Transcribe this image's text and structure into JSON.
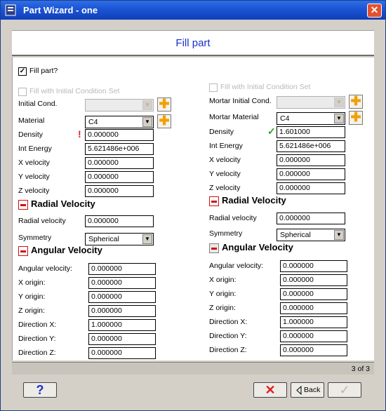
{
  "window": {
    "title": "Part Wizard - one",
    "close_glyph": "✕"
  },
  "header": {
    "title": "Fill part"
  },
  "fill_part": {
    "label": "Fill part?",
    "checked": true
  },
  "left": {
    "fill_initial_label": "Fill with Initial Condition Set",
    "initial_cond_label": "Initial Cond.",
    "material_label": "Material",
    "material_value": "C4",
    "density_label": "Density",
    "density_value": "0.000000",
    "int_energy_label": "Int Energy",
    "int_energy_value": "5.621486e+006",
    "x_velocity_label": "X velocity",
    "x_velocity_value": "0.000000",
    "y_velocity_label": "Y velocity",
    "y_velocity_value": "0.000000",
    "z_velocity_label": "Z velocity",
    "z_velocity_value": "0.000000",
    "radial_section_title": "Radial Velocity",
    "radial_velocity_label": "Radial velocity",
    "radial_velocity_value": "0.000000",
    "symmetry_label": "Symmetry",
    "symmetry_value": "Spherical",
    "angular_section_title": "Angular Velocity",
    "angular_velocity_label": "Angular velocity:",
    "angular_velocity_value": "0.000000",
    "x_origin_label": "X origin:",
    "x_origin_value": "0.000000",
    "y_origin_label": "Y origin:",
    "y_origin_value": "0.000000",
    "z_origin_label": "Z origin:",
    "z_origin_value": "0.000000",
    "direction_x_label": "Direction X:",
    "direction_x_value": "1.000000",
    "direction_y_label": "Direction Y:",
    "direction_y_value": "0.000000",
    "direction_z_label": "Direction Z:",
    "direction_z_value": "0.000000"
  },
  "right": {
    "fill_initial_label": "Fill with Initial Condition Set",
    "mortar_initial_label": "Mortar Initial Cond.",
    "mortar_material_label": "Mortar Material",
    "mortar_material_value": "C4",
    "density_label": "Density",
    "density_value": "1.601000",
    "int_energy_label": "Int Energy",
    "int_energy_value": "5.621486e+006",
    "x_velocity_label": "X velocity",
    "x_velocity_value": "0.000000",
    "y_velocity_label": "Y velocity",
    "y_velocity_value": "0.000000",
    "z_velocity_label": "Z velocity",
    "z_velocity_value": "0.000000",
    "radial_section_title": "Radial Velocity",
    "radial_velocity_label": "Radial velocity",
    "radial_velocity_value": "0.000000",
    "symmetry_label": "Symmetry",
    "symmetry_value": "Spherical",
    "angular_section_title": "Angular Velocity",
    "angular_velocity_label": "Angular velocity:",
    "angular_velocity_value": "0.000000",
    "x_origin_label": "X origin:",
    "x_origin_value": "0.000000",
    "y_origin_label": "Y origin:",
    "y_origin_value": "0.000000",
    "z_origin_label": "Z origin:",
    "z_origin_value": "0.000000",
    "direction_x_label": "Direction X:",
    "direction_x_value": "1.000000",
    "direction_y_label": "Direction Y:",
    "direction_y_value": "0.000000",
    "direction_z_label": "Direction Z:",
    "direction_z_value": "0.000000"
  },
  "icons": {
    "warning": "!",
    "check": "✓",
    "plus": "✚",
    "dropdown": "▼",
    "checkmark": "✓"
  },
  "status": {
    "page": "3 of 3"
  },
  "footer": {
    "help_label": "?",
    "cancel_label": "✕",
    "back_label": "Back",
    "finish_label": "✓"
  },
  "colors": {
    "title_blue": "#1a2fd0",
    "warning_red": "#e02020",
    "ok_green": "#2ca02c",
    "plus_orange": "#f0a000"
  }
}
